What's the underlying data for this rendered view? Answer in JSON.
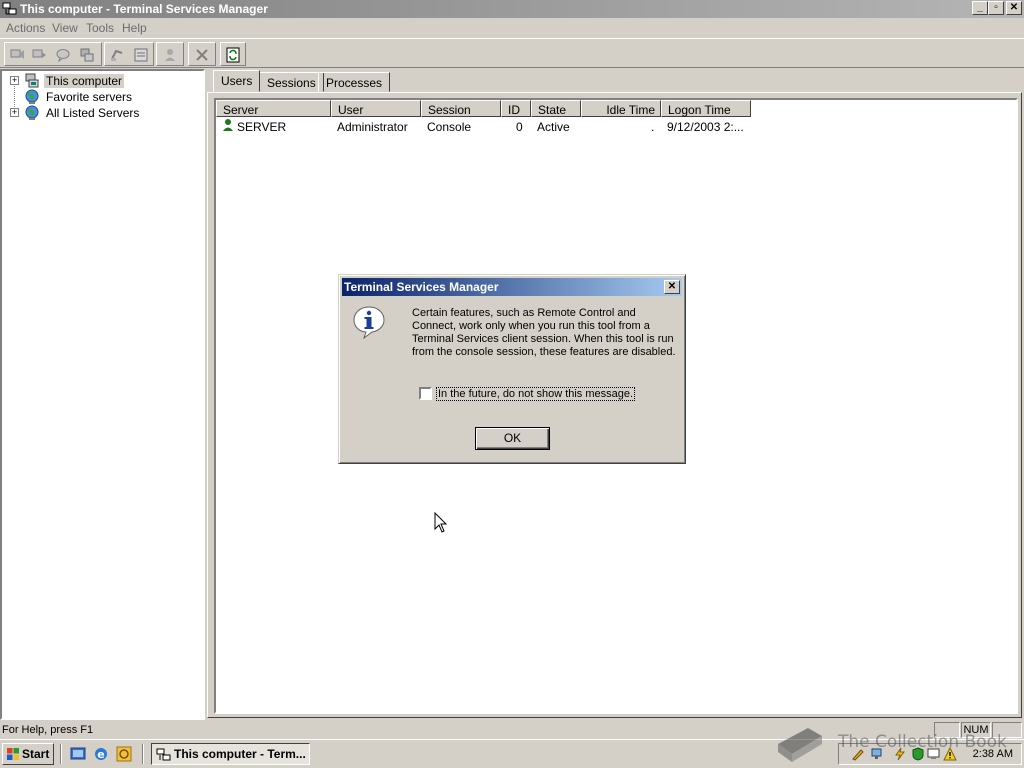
{
  "window": {
    "title": "This computer - Terminal Services Manager",
    "controls": {
      "minimize": "_",
      "maximize": "▫",
      "close": "✕"
    }
  },
  "menu": [
    {
      "label": "Actions"
    },
    {
      "label": "View"
    },
    {
      "label": "Tools"
    },
    {
      "label": "Help"
    }
  ],
  "toolbar": {
    "buttons": [
      "remote-control-icon",
      "connect-icon",
      "send-message-icon",
      "disconnect-icon",
      "reset-icon",
      "status-icon",
      "logoff-icon",
      "end-process-icon",
      "refresh-icon"
    ]
  },
  "tree": {
    "items": [
      {
        "label": "This computer",
        "expander": "+",
        "icon": "computer-icon",
        "selected": true
      },
      {
        "label": "Favorite servers",
        "expander": "",
        "icon": "globe-icon"
      },
      {
        "label": "All Listed Servers",
        "expander": "+",
        "icon": "globe-icon"
      }
    ]
  },
  "tabs": [
    {
      "label": "Users",
      "active": true
    },
    {
      "label": "Sessions"
    },
    {
      "label": "Processes"
    }
  ],
  "table": {
    "columns": [
      "Server",
      "User",
      "Session",
      "ID",
      "State",
      "Idle Time",
      "Logon Time"
    ],
    "rows": [
      {
        "server": "SERVER",
        "user": "Administrator",
        "session": "Console",
        "id": "0",
        "state": "Active",
        "idle": ".",
        "logon": "9/12/2003 2:..."
      }
    ]
  },
  "dialog": {
    "title": "Terminal Services Manager",
    "close": "✕",
    "message": "Certain features, such as Remote Control and Connect, work only when you run this tool from a Terminal Services client session.  When this tool is run from the console session, these features are disabled.",
    "checkbox_label": "In the future, do not show this message.",
    "checkbox_checked": false,
    "ok_label": "OK"
  },
  "statusbar": {
    "text": "For Help, press F1",
    "num": "NUM"
  },
  "taskbar": {
    "start_label": "Start",
    "task_label": "This computer - Term...",
    "clock": "2:38 AM"
  },
  "watermark": {
    "text": "The Collection Book"
  },
  "colors": {
    "face": "#d4d0c8",
    "active_title": "#0a246a",
    "inactive_title": "#808080"
  }
}
